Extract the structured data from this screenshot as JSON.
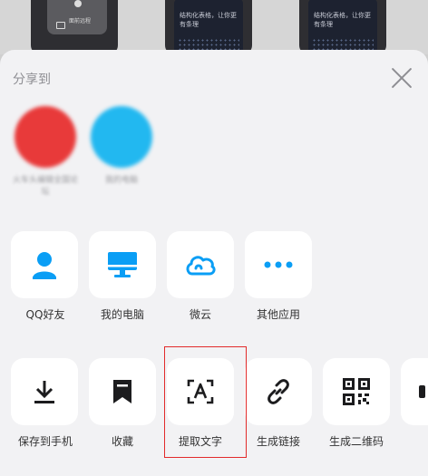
{
  "background": {
    "phone_text": "结构化表格，让你更有条理",
    "control_text": "面前远程"
  },
  "sheet": {
    "title": "分享到",
    "recent": [
      {
        "name": "火车头编辑全国论坛",
        "color": "#e83a3a"
      },
      {
        "name": "我的电脑",
        "color": "#22b8f0"
      }
    ],
    "row1": [
      {
        "label": "QQ好友",
        "icon": "person-icon"
      },
      {
        "label": "我的电脑",
        "icon": "monitor-icon"
      },
      {
        "label": "微云",
        "icon": "cloud-icon"
      },
      {
        "label": "其他应用",
        "icon": "more-dots-icon"
      }
    ],
    "row2": [
      {
        "label": "保存到手机",
        "icon": "download-icon"
      },
      {
        "label": "收藏",
        "icon": "bookmark-icon"
      },
      {
        "label": "提取文字",
        "icon": "text-extract-icon"
      },
      {
        "label": "生成链接",
        "icon": "link-icon"
      },
      {
        "label": "生成二维码",
        "icon": "qrcode-icon"
      }
    ]
  },
  "colors": {
    "accent": "#0a9ef5",
    "highlight": "#e22b2b"
  }
}
